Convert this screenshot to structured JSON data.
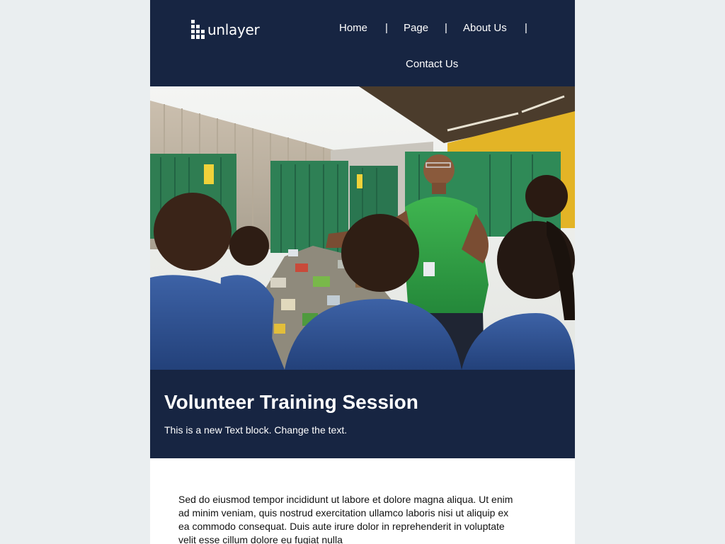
{
  "page": {
    "background_color": "#eaeef0",
    "brand_color": "#172542"
  },
  "header": {
    "logo": {
      "text": "unlayer",
      "icon": "unlayer-logo-icon"
    },
    "nav": {
      "items": [
        {
          "label": "Home"
        },
        {
          "label": "Page"
        },
        {
          "label": "About Us"
        },
        {
          "label": "Contact Us"
        }
      ],
      "separator": "|"
    }
  },
  "hero": {
    "image_description": "Volunteer in green polo shirt explaining recycling to a group of students in blue jackets in front of green waste containers"
  },
  "banner": {
    "title": "Volunteer Training Session",
    "subtitle": "This is a new Text block. Change the text."
  },
  "content": {
    "paragraph": "Sed do eiusmod tempor incididunt ut labore et dolore magna aliqua. Ut enim ad minim veniam, quis nostrud exercitation ullamco laboris nisi ut aliquip ex ea commodo consequat. Duis aute irure dolor in reprehenderit in voluptate velit esse cillum dolore eu fugiat nulla"
  }
}
